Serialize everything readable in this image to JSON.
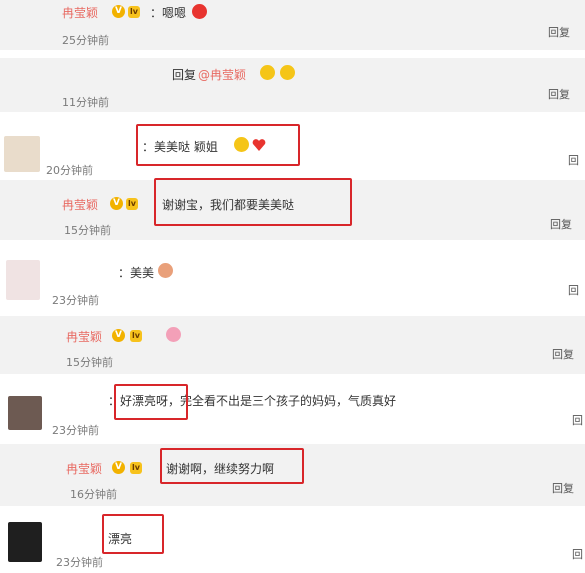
{
  "comments": [
    {
      "name": "冉莹颖",
      "text": "：嗯嗯",
      "time": "25分钟前",
      "reply": "回复"
    },
    {
      "name": "",
      "text": "回复",
      "mention": "@冉莹颖",
      "time": "11分钟前",
      "reply": "回复"
    },
    {
      "name": "",
      "text": "：美美哒 颖姐",
      "time": "20分钟前",
      "reply": "回"
    },
    {
      "name": "冉莹颖",
      "text": "谢谢宝，我们都要美美哒",
      "time": "15分钟前",
      "reply": "回复"
    },
    {
      "name": "",
      "text": "：美美",
      "time": "23分钟前",
      "reply": "回"
    },
    {
      "name": "冉莹颖",
      "text": "",
      "time": "15分钟前",
      "reply": "回复"
    },
    {
      "name": "",
      "text": "：好漂亮呀，完全看不出是三个孩子的妈妈，气质真好",
      "time": "23分钟前",
      "reply": "回"
    },
    {
      "name": "冉莹颖",
      "text": "谢谢啊，继续努力啊",
      "time": "16分钟前",
      "reply": "回复"
    },
    {
      "name": "",
      "text": "漂亮",
      "time": "23分钟前",
      "reply": "回"
    }
  ],
  "colors": {
    "name_accent": "#e86a62",
    "highlight_box": "#d8262a",
    "reply_bg": "#f2f2f2"
  }
}
